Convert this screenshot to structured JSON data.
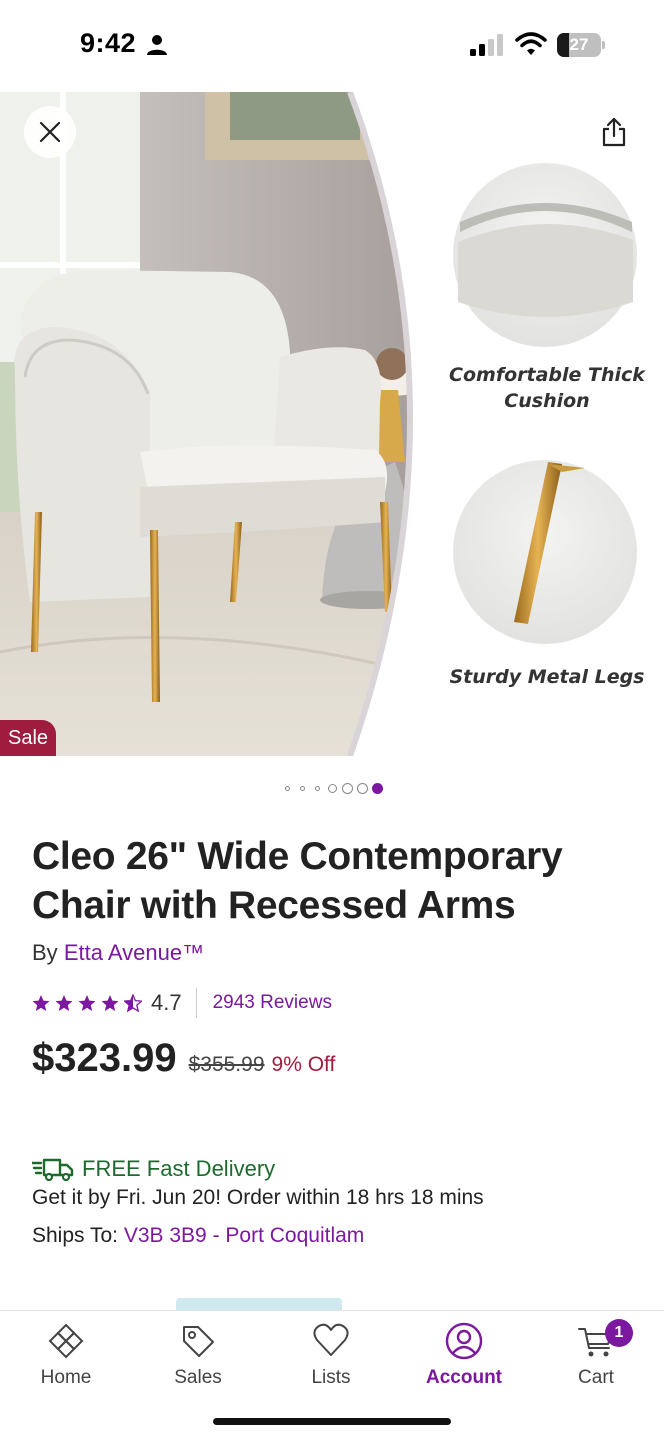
{
  "status_bar": {
    "time": "9:42",
    "battery_level": "27",
    "battery_fraction": 0.27
  },
  "hero": {
    "callouts": [
      "Comfortable Thick Cushion",
      "Sturdy Metal Legs"
    ],
    "sale_badge": "Sale",
    "carousel": {
      "total": 7,
      "active_index": 6
    }
  },
  "product": {
    "title": "Cleo 26\" Wide Contemporary Chair with Recessed Arms",
    "by_prefix": "By",
    "brand": "Etta Avenue™",
    "rating": {
      "stars": 4.5,
      "value": "4.7",
      "reviews": "2943 Reviews"
    },
    "price": {
      "current": "$323.99",
      "original": "$355.99",
      "discount": "9% Off"
    }
  },
  "delivery": {
    "label": "FREE Fast Delivery",
    "detail": "Get it by Fri. Jun 20! Order within 18 hrs 18 mins",
    "ships_to_label": "Ships To:",
    "ships_to_value": "V3B 3B9 - Port Coquitlam"
  },
  "tab_bar": {
    "tabs": [
      {
        "label": "Home",
        "icon": "home-icon"
      },
      {
        "label": "Sales",
        "icon": "tag-icon"
      },
      {
        "label": "Lists",
        "icon": "heart-icon"
      },
      {
        "label": "Account",
        "icon": "account-icon",
        "active": true
      },
      {
        "label": "Cart",
        "icon": "cart-icon",
        "badge": "1"
      }
    ]
  },
  "colors": {
    "brand_purple": "#7b189f",
    "sale_red": "#9f1c3f",
    "delivery_green": "#1e6a2e"
  }
}
